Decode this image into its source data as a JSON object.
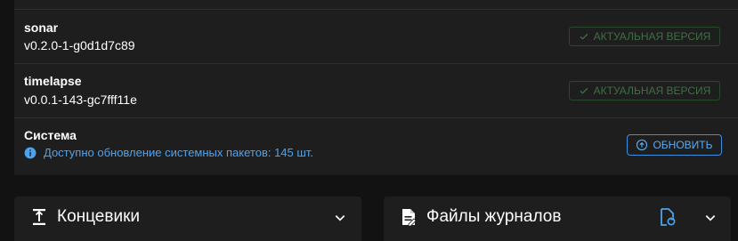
{
  "updates": [
    {
      "name": "sonar",
      "version": "v0.2.0-1-g0d1d7c89",
      "status": "АКТУАЛЬНАЯ ВЕРСИЯ"
    },
    {
      "name": "timelapse",
      "version": "v0.0.1-143-gc7fff11e",
      "status": "АКТУАЛЬНАЯ ВЕРСИЯ"
    }
  ],
  "system": {
    "name": "Система",
    "info": "Доступно обновление системных пакетов: 145 шт.",
    "update_label": "ОБНОВИТЬ"
  },
  "panels": {
    "endstops_title": "Концевики",
    "logs_title": "Файлы журналов"
  },
  "icons": {
    "status": "check-icon",
    "info": "info-icon",
    "update": "update-icon",
    "endstops": "endstop-icon",
    "logs": "log-file-icon",
    "rollover": "file-refresh-icon",
    "expand": "chevron-down-icon"
  },
  "colors": {
    "background": "#121212",
    "card": "#1e1e1e",
    "success": "#3f6f43",
    "info": "#4ea3ee",
    "primary": "#5aaaf0"
  }
}
